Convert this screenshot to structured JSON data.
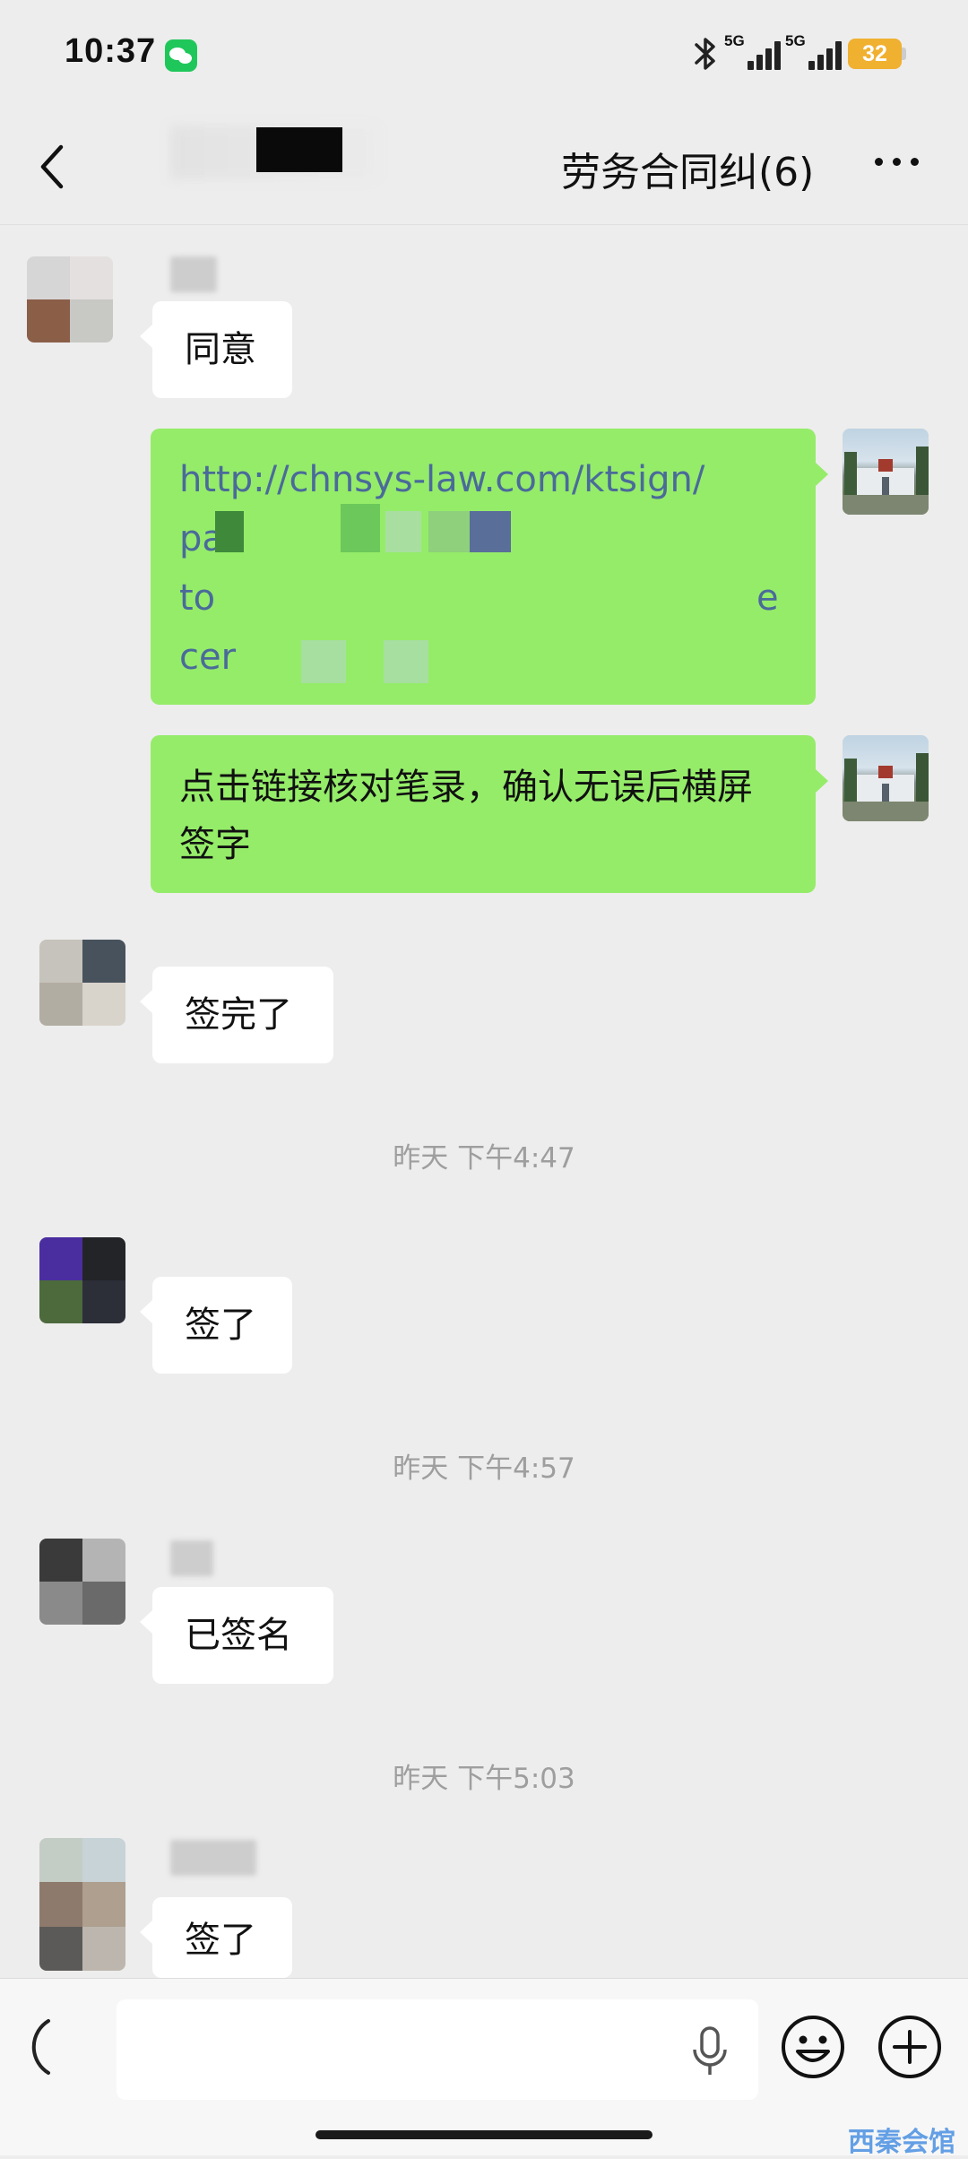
{
  "status_bar": {
    "time": "10:37",
    "signal1_label": "5G",
    "signal2_label": "5G",
    "battery": "32",
    "accent_battery": "#f0b030",
    "wechat_color": "#1fc75b"
  },
  "nav": {
    "title": "劳务合同纠(6)",
    "back_icon": "chevron-left-icon",
    "more_icon": "more-dots-icon"
  },
  "messages": [
    {
      "side": "in",
      "text": "同意"
    },
    {
      "side": "out",
      "type": "link",
      "lines": [
        "http://chnsys-law.com/ktsign/",
        "pa",
        "to",
        "cer"
      ],
      "tail_e": "e"
    },
    {
      "side": "out",
      "text": "点击链接核对笔录，确认无误后横屏签字"
    },
    {
      "side": "in",
      "text": "签完了"
    },
    {
      "type": "time",
      "text": "昨天 下午4:47"
    },
    {
      "side": "in",
      "text": "签了"
    },
    {
      "type": "time",
      "text": "昨天 下午4:57"
    },
    {
      "side": "in",
      "text": "已签名"
    },
    {
      "type": "time",
      "text": "昨天 下午5:03"
    },
    {
      "side": "in",
      "text": "签了"
    }
  ],
  "input": {
    "placeholder": "",
    "voice_icon": "voice-toggle-icon",
    "mic_icon": "microphone-icon",
    "emoji_icon": "emoji-icon",
    "plus_icon": "plus-icon"
  },
  "watermark": "西秦会馆",
  "colors": {
    "chat_bg": "#ededed",
    "bubble_out": "#95ec69",
    "bubble_in": "#ffffff",
    "link": "#4a6a9a"
  }
}
